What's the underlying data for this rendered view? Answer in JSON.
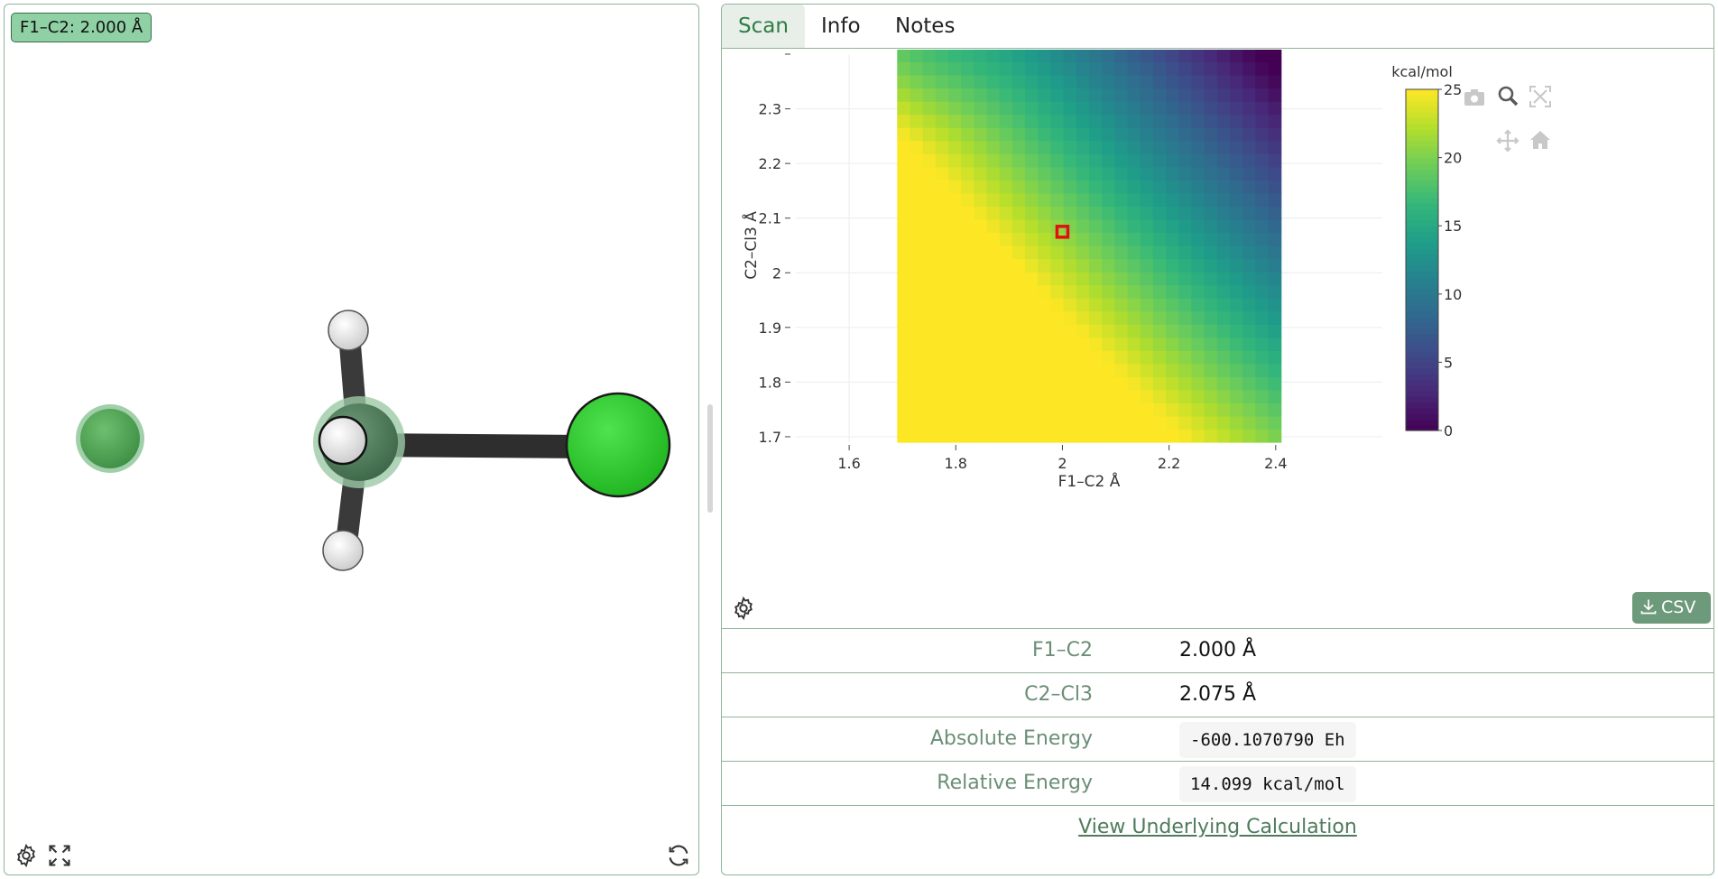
{
  "viewer": {
    "distance_badge": "F1–C2: 2.000 Å",
    "icons": [
      "gear-icon",
      "fullscreen-icon",
      "rotate-icon"
    ]
  },
  "tabs": [
    {
      "label": "Scan",
      "active": true
    },
    {
      "label": "Info",
      "active": false
    },
    {
      "label": "Notes",
      "active": false
    }
  ],
  "chart_data": {
    "type": "heatmap",
    "xlabel": "F1–C2 Å",
    "ylabel": "C2–Cl3 Å",
    "x_ticks": [
      "1.6",
      "1.8",
      "2",
      "2.2",
      "2.4"
    ],
    "y_ticks": [
      "1.7",
      "1.8",
      "1.9",
      "2",
      "2.1",
      "2.2",
      "2.3"
    ],
    "xlim": [
      1.5,
      2.6
    ],
    "ylim": [
      1.69,
      2.4
    ],
    "x_range": [
      1.69,
      2.41
    ],
    "y_range": [
      1.69,
      2.41
    ],
    "grid": true,
    "colorscale": "viridis",
    "colorbar": {
      "title": "kcal/mol",
      "ticks": [
        "0",
        "5",
        "10",
        "15",
        "20",
        "25"
      ],
      "min": 0,
      "max": 25
    },
    "selected_point": {
      "x": 2.0,
      "y": 2.075
    }
  },
  "csv_button": "CSV",
  "details": [
    {
      "label": "F1–C2",
      "value": "2.000 Å",
      "code": false
    },
    {
      "label": "C2–Cl3",
      "value": "2.075 Å",
      "code": false
    },
    {
      "label": "Absolute Energy",
      "value": "-600.1070790 Eh",
      "code": true
    },
    {
      "label": "Relative Energy",
      "value": "14.099 kcal/mol",
      "code": true
    }
  ],
  "view_link": "View Underlying Calculation",
  "colors": {
    "accent": "#2e7d45",
    "border": "#8fb59a",
    "badge": "#8fd1a5",
    "selected": "#e01010"
  }
}
